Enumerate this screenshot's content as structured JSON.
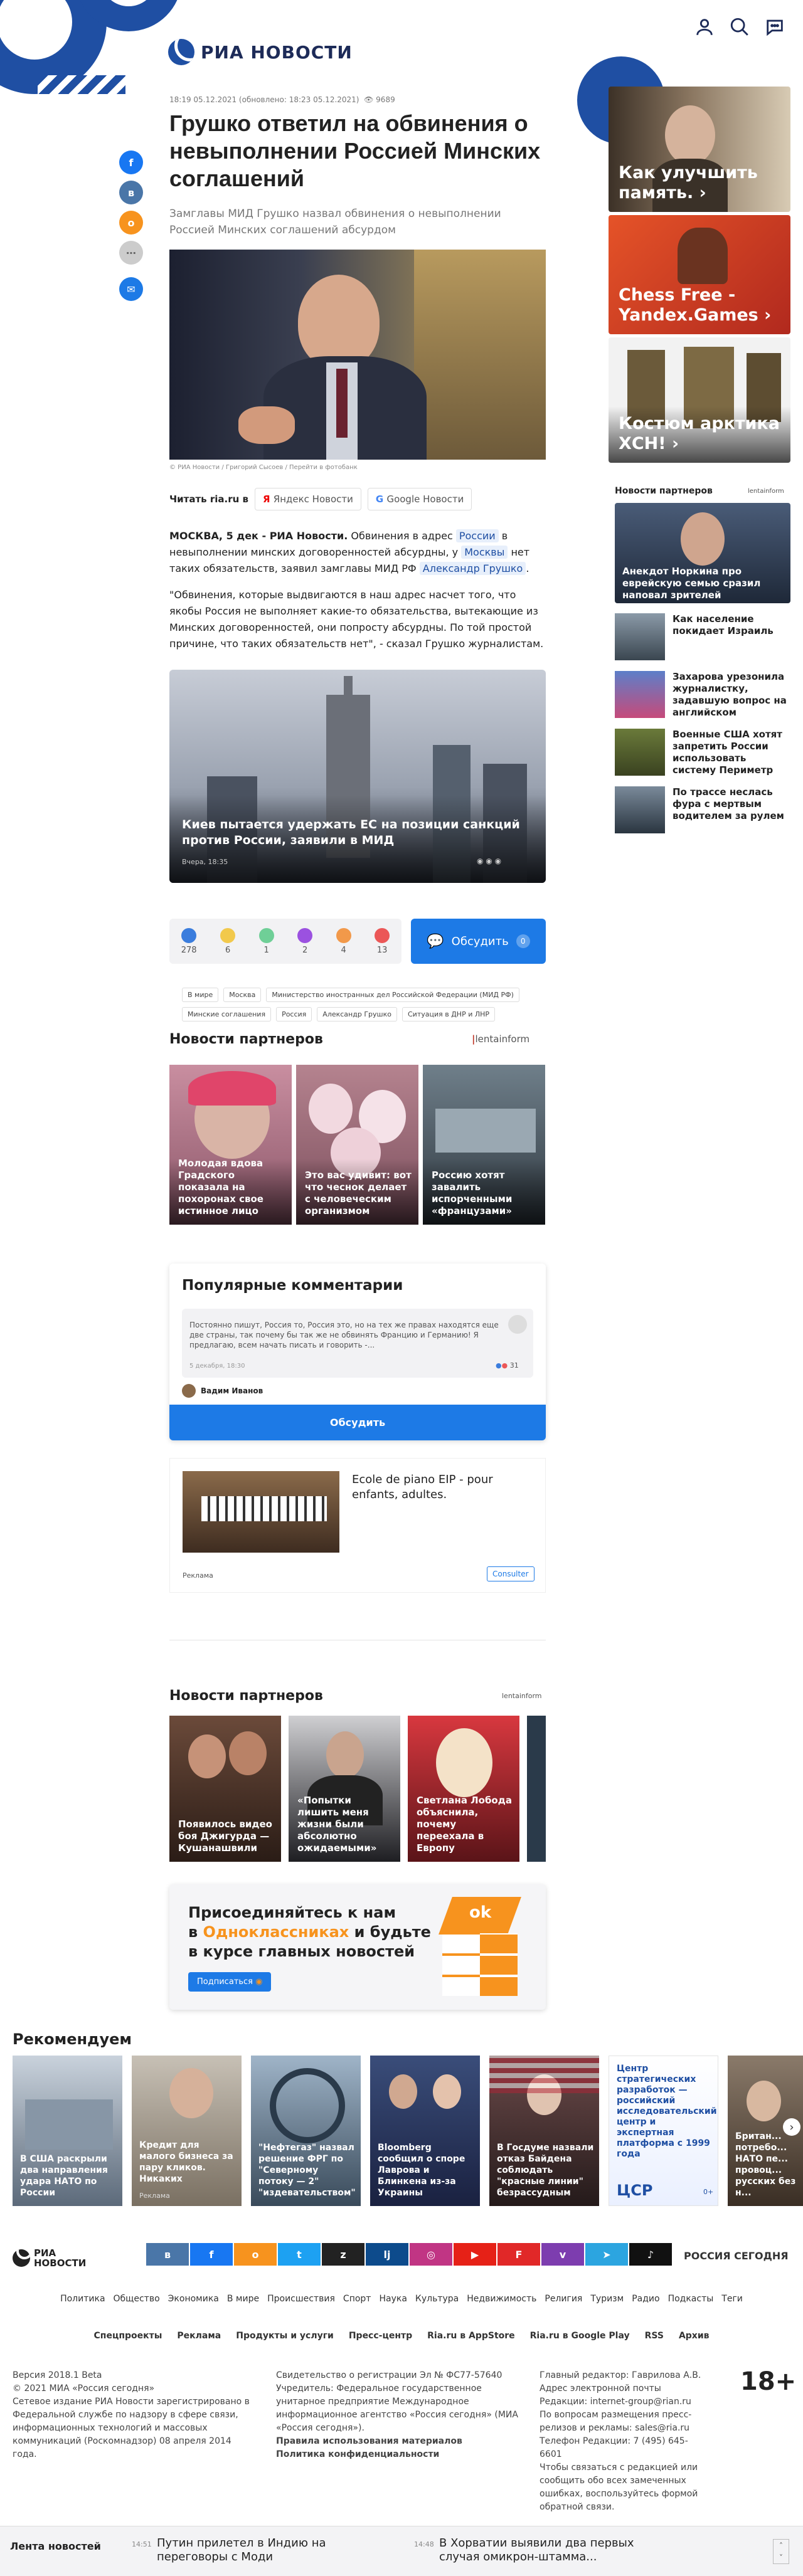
{
  "header": {
    "logo_text": "РИА НОВОСТИ",
    "icons": [
      "user-icon",
      "search-icon",
      "chat-icon"
    ]
  },
  "share": [
    "facebook-icon",
    "vk-icon",
    "ok-icon",
    "more-icon",
    "comments-icon"
  ],
  "article": {
    "meta": "18:19 05.12.2021 (обновлено: 18:23 05.12.2021)",
    "views": "9689",
    "title": "Грушко ответил на обвинения о невыполнении Россией Минских соглашений",
    "subtitle": "Замглавы МИД Грушко назвал обвинения о невыполнении Россией Минских соглашений абсурдом",
    "photo_caption": "© РИА Новости / Григорий Сысоев / Перейти в фотобанк",
    "read_on": "Читать ria.ru в",
    "yandex": "Яндекс Новости",
    "google": "Google Новости",
    "p1_lead": "МОСКВА, 5 дек - РИА Новости.",
    "p1_a": "Обвинения в адрес",
    "p1_tag1": "России",
    "p1_b": "в невыполнении минских договоренностей абсурдны, у",
    "p1_tag2": "Москвы",
    "p1_c": "нет таких обязательств, заявил замглавы МИД РФ",
    "p1_tag3": "Александр Грушко",
    "p1_d": ".",
    "p2": "\"Обвинения, которые выдвигаются в наш адрес насчет того, что якобы Россия не выполняет какие-то обязательства, вытекающие из Минских договоренностей, они попросту абсурдны. По той простой причине, что таких обязательств нет\", - сказал Грушко журналистам.",
    "related_title": "Киев пытается удержать ЕС на позиции санкций против России, заявили в МИД",
    "related_time": "Вчера, 18:35"
  },
  "reactions": [
    {
      "count": "278",
      "color": "#3b7ddd"
    },
    {
      "count": "6",
      "color": "#f2c94c"
    },
    {
      "count": "1",
      "color": "#6fcf97"
    },
    {
      "count": "2",
      "color": "#9b51e0"
    },
    {
      "count": "4",
      "color": "#f2994a"
    },
    {
      "count": "13",
      "color": "#eb5757"
    }
  ],
  "discuss": {
    "label": "Обсудить",
    "count": "0"
  },
  "tags": [
    "В мире",
    "Москва",
    "Министерство иностранных дел Российской Федерации (МИД РФ)",
    "Минские соглашения",
    "Россия",
    "Александр Грушко",
    "Ситуация в ДНР и ЛНР"
  ],
  "partners1": {
    "title": "Новости партнеров",
    "brand": "lentainform",
    "items": [
      "Молодая вдова Градского показала на похоронах свое истинное лицо",
      "Это вас удивит: вот что чеснок делает с человеческим организмом",
      "Россию хотят завалить испорченными «французами»"
    ]
  },
  "popular": {
    "title": "Популярные комментарии",
    "comment": "Постоянно пишут, Россия то, Россия это, но на тех же правах находятся еще две страны, так почему бы так же не обвинять Францию и Германию! Я предлагаю, всем начать писать и говорить -...",
    "date": "5 декабря, 18:30",
    "likes": "31",
    "author": "Вадим Иванов",
    "button": "Обсудить"
  },
  "ad": {
    "text": "Ecole de piano EIP - pour enfants, adultes.",
    "label": "Реклама",
    "button": "Consulter"
  },
  "partners2": {
    "title": "Новости партнеров",
    "brand": "lentainform",
    "items": [
      "Появилось видео боя Джигурда — Кушанашвили",
      "«Попытки лишить меня жизни были абсолютно ожидаемыми»",
      "Светлана Лобода объяснила, почему переехала в Европу"
    ]
  },
  "ok": {
    "line1": "Присоединяйтесь к нам",
    "line2_a": "в ",
    "line2_b": "Одноклассниках",
    "line2_c": " и будьте",
    "line3": "в курсе главных новостей",
    "button": "Подписаться"
  },
  "recommend": {
    "title": "Рекомендуем",
    "items": [
      "В США раскрыли два направления удара НАТО по России",
      "Кредит для малого бизнеса за пару кликов. Никаких",
      "\"Нефтегаз\" назвал решение ФРГ по \"Северному потоку — 2\" \"издевательством\"",
      "Bloomberg сообщил о споре Лаврова и Блинкена из-за Украины",
      "В Госдуме назвали отказ Байдена соблюдать \"красные линии\" безрассудным",
      "Центр стратегических разработок — российский исследовательский центр и экспертная платформа с 1999 года",
      "Британ... потребо... НАТО пе... провоц... русских без н..."
    ],
    "ad_label": "Реклама",
    "csr": "ЦСР"
  },
  "right": {
    "cards": [
      "Как улучшить память. ›",
      "Chess Free - Yandex.Games ›",
      "Костюм арктика ХСН! ›"
    ],
    "partners_title": "Новости партнеров",
    "partners_brand": "lentainform",
    "partners": [
      "Анекдот Норкина про еврейскую семью сразил наповал зрителей",
      "Как население покидает Израиль",
      "Захарова урезонила журналистку, задавшую вопрос на английском",
      "Военные США хотят запретить России использовать систему Периметр",
      "По трассе неслась фура с мертвым водителем за рулем"
    ]
  },
  "footer": {
    "logo": "РИА НОВОСТИ",
    "rs": "РОССИЯ СЕГОДНЯ",
    "socials": [
      "vk-icon",
      "facebook-icon",
      "ok-icon",
      "twitter-icon",
      "zen-icon",
      "livejournal-icon",
      "instagram-icon",
      "youtube-icon",
      "flipboard-icon",
      "viber-icon",
      "telegram-icon",
      "tiktok-icon"
    ],
    "nav": [
      "Политика",
      "Общество",
      "Экономика",
      "В мире",
      "Происшествия",
      "Спорт",
      "Наука",
      "Культура",
      "Недвижимость",
      "Религия",
      "Туризм",
      "Радио",
      "Подкасты",
      "Теги"
    ],
    "nav2": [
      "Спецпроекты",
      "Реклама",
      "Продукты и услуги",
      "Пресс-центр",
      "Ria.ru в AppStore",
      "Ria.ru в Google Play",
      "RSS",
      "Архив"
    ],
    "col1": [
      "Версия 2018.1 Beta",
      "© 2021 МИА «Россия сегодня»",
      "Сетевое издание РИА Новости зарегистрировано в Федеральной службе по надзору в сфере связи, информационных технологий и массовых коммуникаций (Роскомнадзор) 08 апреля 2014 года."
    ],
    "col2": [
      "Свидетельство о регистрации Эл № ФС77-57640",
      "Учредитель: Федеральное государственное унитарное предприятие Международное информационное агентство «Россия сегодня» (МИА «Россия сегодня»).",
      "Правила использования материалов",
      "Политика конфиденциальности"
    ],
    "col3": [
      "Главный редактор: Гаврилова А.В.",
      "Адрес электронной почты Редакции: internet-group@rian.ru",
      "По вопросам размещения пресс-релизов и рекламы: sales@ria.ru",
      "Телефон Редакции: 7 (495) 645-6601",
      "Чтобы связаться с редакцией или сообщить обо всех замеченных ошибках, воспользуйтесь формой обратной связи."
    ],
    "age": "18+"
  },
  "ticker": {
    "label": "Лента новостей",
    "items": [
      {
        "time": "14:51",
        "text": "Путин прилетел в Индию на переговоры с Моди"
      },
      {
        "time": "14:48",
        "text": "В Хорватии выявили два первых случая омикрон-штамма..."
      }
    ]
  }
}
